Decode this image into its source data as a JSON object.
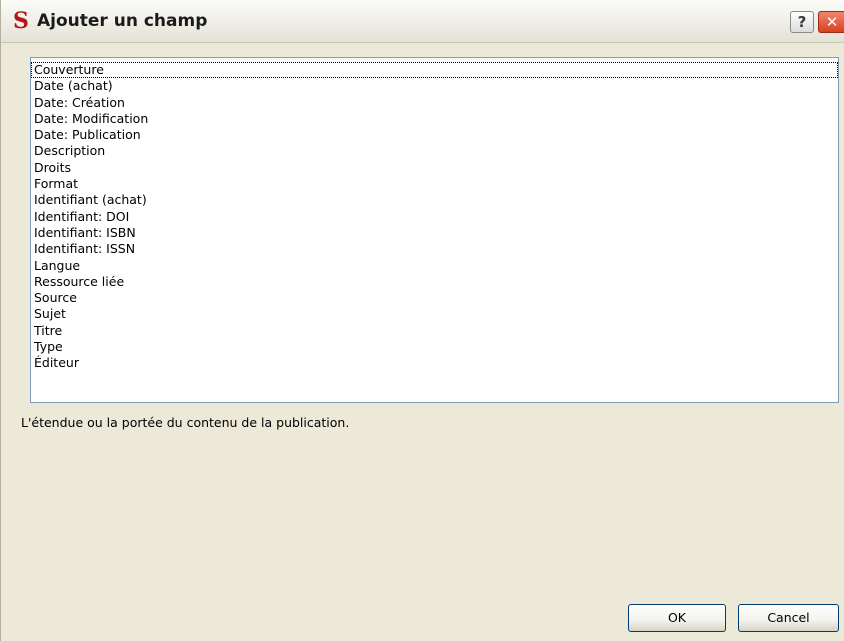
{
  "window": {
    "title": "Ajouter un champ",
    "app_icon": "S",
    "help_label": "?",
    "close_label": "✕"
  },
  "field_list": {
    "selected_index": 0,
    "items": [
      "Couverture",
      "Date (achat)",
      "Date: Création",
      "Date: Modification",
      "Date: Publication",
      "Description",
      "Droits",
      "Format",
      "Identifiant (achat)",
      "Identifiant: DOI",
      "Identifiant: ISBN",
      "Identifiant: ISSN",
      "Langue",
      "Ressource liée",
      "Source",
      "Sujet",
      "Titre",
      "Type",
      "Éditeur"
    ]
  },
  "description": "L'étendue ou la portée du contenu de la publication.",
  "buttons": {
    "ok": "OK",
    "cancel": "Cancel"
  },
  "colors": {
    "title_icon": "#b3151b",
    "close_button": "#d9401f",
    "list_border": "#7f9db9",
    "dialog_background": "#ece9d8"
  }
}
